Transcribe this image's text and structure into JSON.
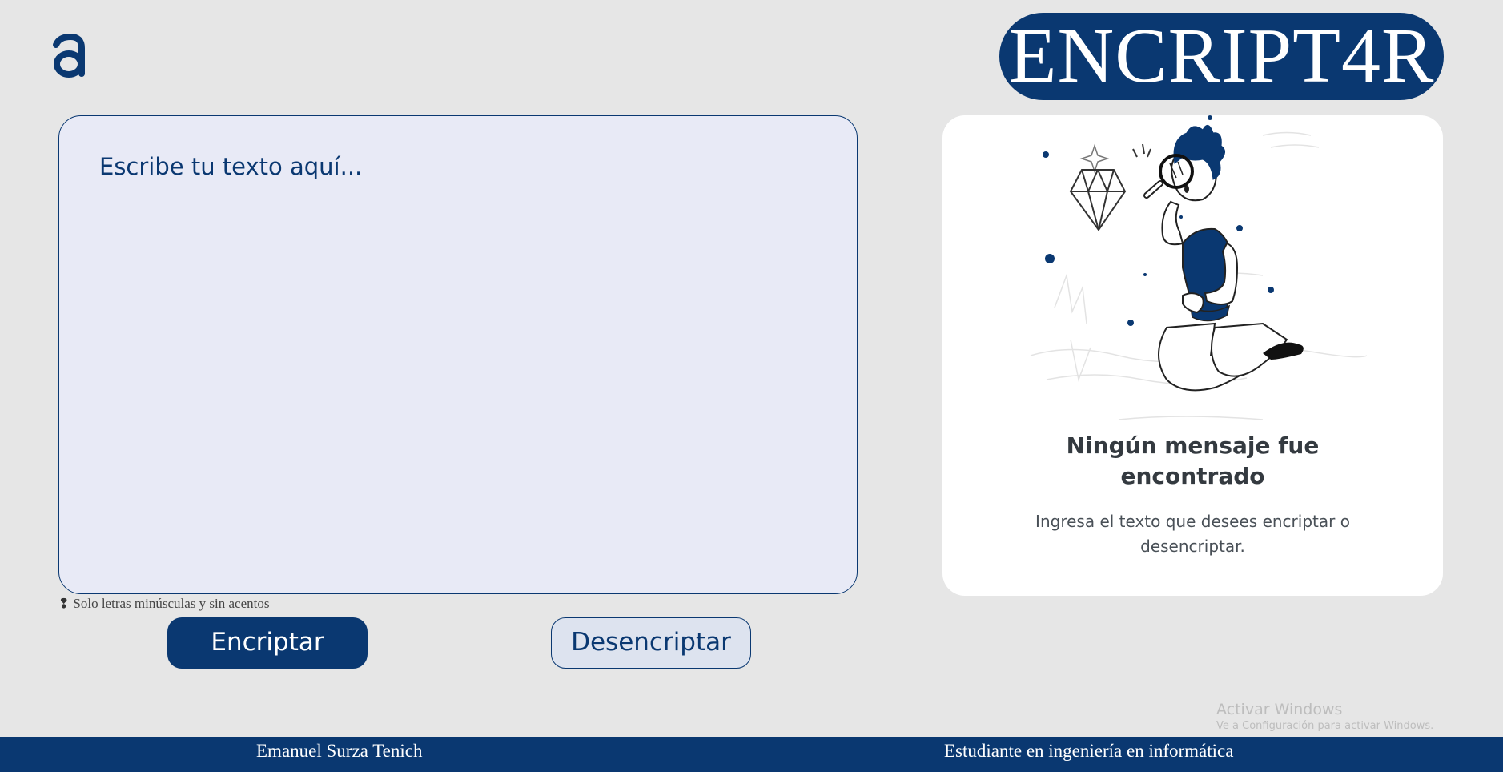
{
  "header": {
    "logo_icon": "alura-a-logo-icon",
    "brand_title": "ENCRIPT4R"
  },
  "input": {
    "placeholder": "Escribe tu texto aquí...",
    "value": ""
  },
  "hint": {
    "icon": "exclamation-icon",
    "text": "Solo letras minúsculas y sin acentos"
  },
  "buttons": {
    "encrypt_label": "Encriptar",
    "decrypt_label": "Desencriptar"
  },
  "output": {
    "illustration_icon": "boy-with-magnifier-illustration",
    "title": "Ningún mensaje fue encontrado",
    "subtitle": "Ingresa el texto que desees encriptar o desencriptar."
  },
  "watermark": {
    "title": "Activar Windows",
    "subtitle": "Ve a Configuración para activar Windows."
  },
  "footer": {
    "author": "Emanuel Surza Tenich",
    "role": "Estudiante en ingeniería en informática"
  },
  "colors": {
    "primary": "#0a3871",
    "background": "#e6e6e6",
    "input_bg": "#e8eaf6",
    "panel_bg": "#ffffff"
  }
}
